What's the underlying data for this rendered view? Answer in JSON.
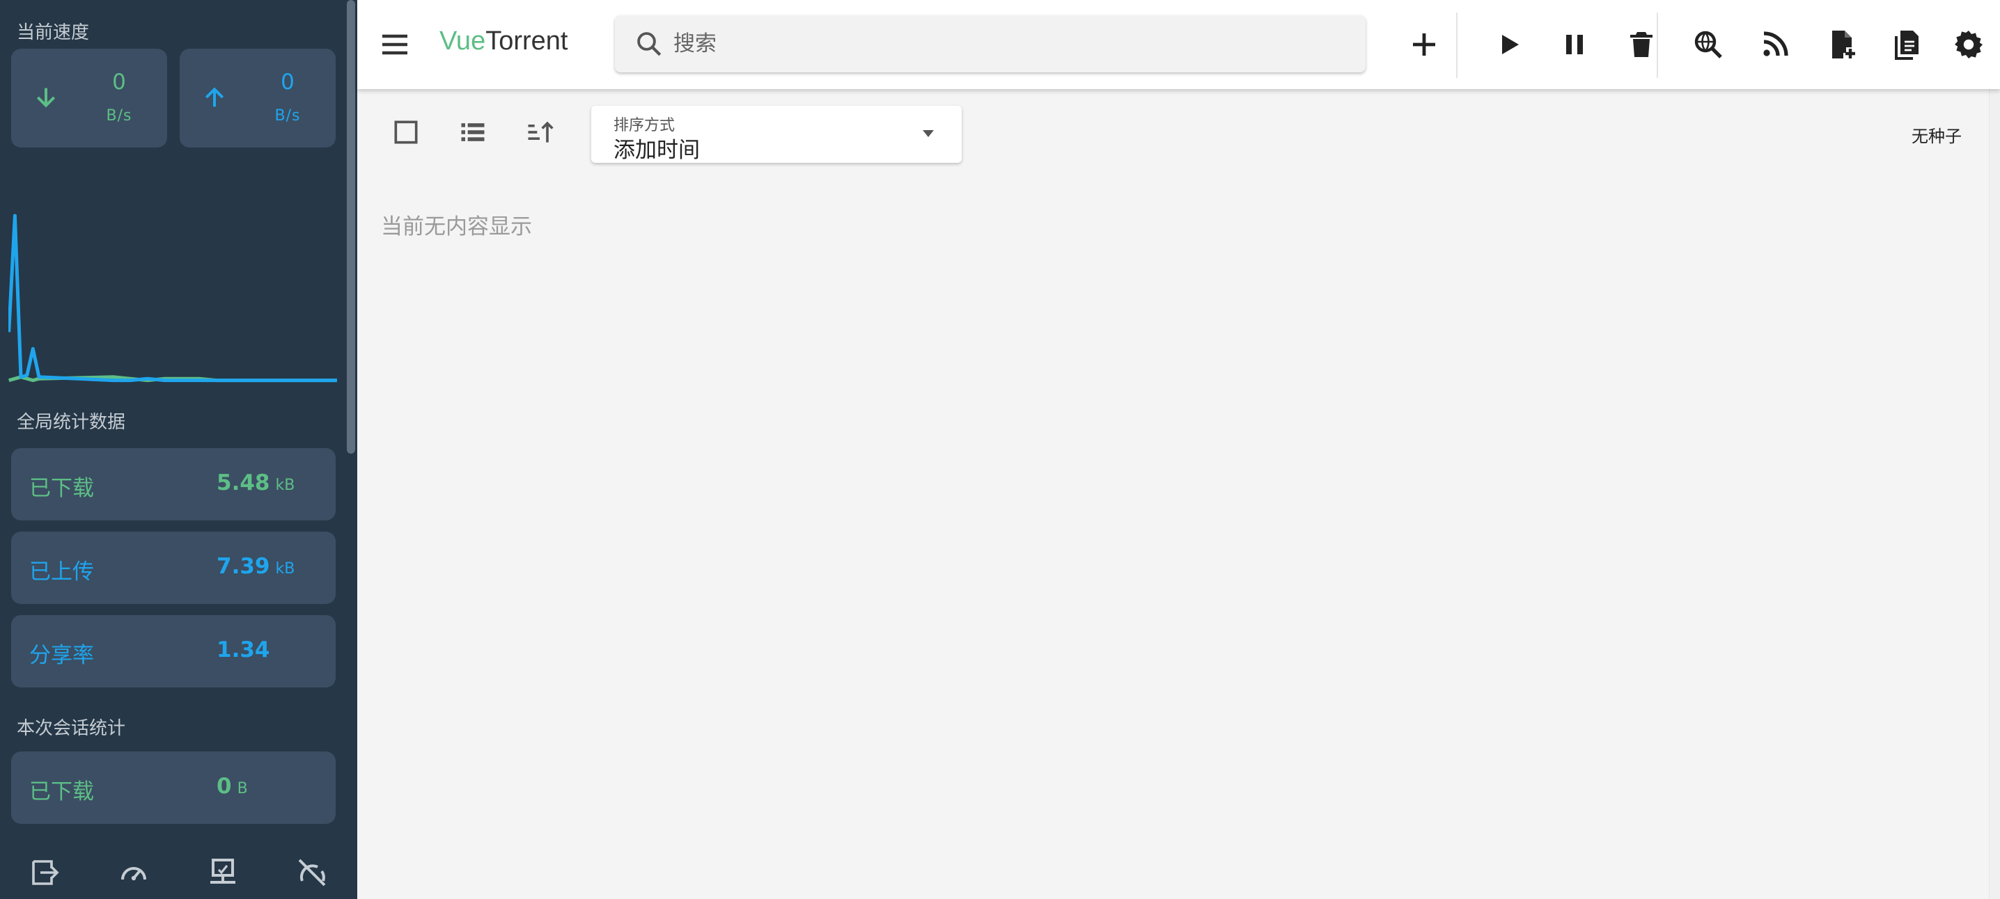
{
  "app": {
    "title_part1": "Vue",
    "title_part2": "Torrent"
  },
  "colors": {
    "accent_green": "#5dbe86",
    "accent_blue": "#1fa5ed",
    "sidebar_bg": "#263747",
    "card_bg": "#3b4e63"
  },
  "search": {
    "placeholder": "搜索"
  },
  "toolbar": {
    "icons": [
      "add-icon",
      "play-icon",
      "pause-icon",
      "delete-icon",
      "search-web-icon",
      "rss-icon",
      "add-file-icon",
      "logs-icon",
      "settings-icon"
    ]
  },
  "sidebar": {
    "current_speed_label": "当前速度",
    "download_speed": {
      "value": "0",
      "unit": "B/s"
    },
    "upload_speed": {
      "value": "0",
      "unit": "B/s"
    },
    "global_stats_label": "全局统计数据",
    "global_stats": [
      {
        "label": "已下载",
        "value": "5.48",
        "unit": "kB"
      },
      {
        "label": "已上传",
        "value": "7.39",
        "unit": "kB"
      },
      {
        "label": "分享率",
        "value": "1.34",
        "unit": ""
      }
    ],
    "session_stats_label": "本次会话统计",
    "session_stats": [
      {
        "label": "已下载",
        "value": "0",
        "unit": "B"
      }
    ],
    "bottom_icons": [
      "logout-icon",
      "speedometer-icon",
      "network-computer-icon",
      "alt-speed-off-icon"
    ]
  },
  "main": {
    "sort_label": "排序方式",
    "sort_value": "添加时间",
    "seed_count_text": "无种子",
    "empty_message": "当前无内容显示"
  },
  "chart_data": {
    "type": "line",
    "title": "",
    "series": [
      {
        "color": "#1fa5ed",
        "values": [
          30,
          100,
          3,
          4,
          20,
          3,
          1,
          1,
          2,
          1,
          1,
          1,
          1,
          1,
          1,
          1,
          1,
          1,
          1,
          1
        ]
      },
      {
        "color": "#5dbe86",
        "values": [
          1,
          2,
          3,
          2,
          1,
          2,
          3,
          2,
          1,
          2,
          2,
          2,
          1,
          1,
          1,
          1,
          1,
          1,
          1,
          1
        ]
      }
    ]
  }
}
